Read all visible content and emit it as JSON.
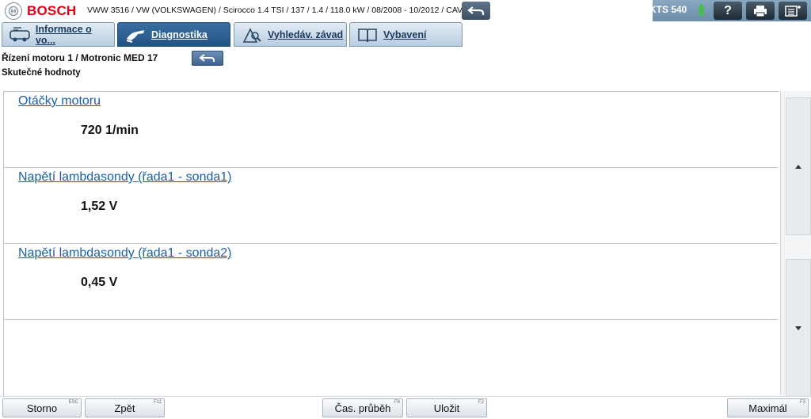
{
  "header": {
    "brand": "BOSCH",
    "vehicle_info": "VWW 3516 / VW (VOLKSWAGEN) / Scirocco 1.4 TSI / 137 / 1.4 / 118.0 kW / 08/2008 - 10/2012 / CAVD",
    "device": "KTS 540",
    "help_label": "?"
  },
  "tabs": [
    {
      "label": "Informace o vo..."
    },
    {
      "label": "Diagnostika"
    },
    {
      "label": "Vyhledáv. závad"
    },
    {
      "label": "Vybavení"
    }
  ],
  "module": {
    "title": "Řízení motoru 1 / Motronic MED 17",
    "subtitle": "Skutečné hodnoty"
  },
  "values": [
    {
      "label": "Otáčky motoru",
      "value": "720 1/min"
    },
    {
      "label": "Napětí lambdasondy (řada1 - sonda1)",
      "value": "1,52 V"
    },
    {
      "label": "Napětí lambdasondy (řada1 - sonda2)",
      "value": "0,45 V"
    }
  ],
  "footer": {
    "storno": {
      "label": "Storno",
      "key": "ESC"
    },
    "zpet": {
      "label": "Zpět",
      "key": "F11"
    },
    "cas": {
      "label": "Čas. průběh",
      "key": "F6"
    },
    "ulozit": {
      "label": "Uložit",
      "key": "F2"
    },
    "maximal": {
      "label": "Maximál",
      "key": "F3"
    }
  },
  "colors": {
    "brand_red": "#e20015",
    "active_tab": "#2d5f92",
    "link_blue": "#1c5fa8"
  },
  "icons": [
    "bosch-logo-icon",
    "back-arrow-icon",
    "bluetooth-icon",
    "help-icon",
    "print-icon",
    "menu-icon",
    "car-info-icon",
    "diagnostics-hand-icon",
    "search-fault-icon",
    "book-icon",
    "scroll-up-icon",
    "scroll-down-icon"
  ]
}
